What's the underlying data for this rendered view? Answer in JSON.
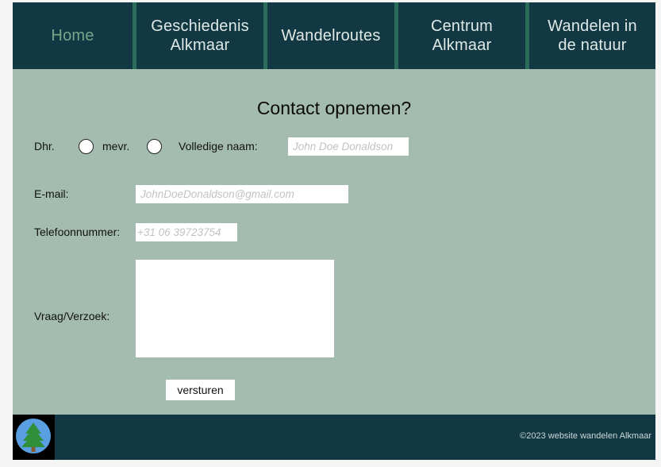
{
  "nav": {
    "items": [
      {
        "label": "Home",
        "active": true
      },
      {
        "label": "Geschiedenis\nAlkmaar"
      },
      {
        "label": "Wandelroutes"
      },
      {
        "label": "Centrum\nAlkmaar"
      },
      {
        "label": "Wandelen in\nde natuur"
      }
    ]
  },
  "form": {
    "title": "Contact opnemen?",
    "salutation_dhr": "Dhr.",
    "salutation_mevr": "mevr.",
    "name_label": "Volledige naam:",
    "name_placeholder": "John Doe Donaldson",
    "email_label": "E-mail:",
    "email_placeholder": "JohnDoeDonaldson@gmail.com",
    "phone_label": "Telefoonnummer:",
    "phone_placeholder": "+31 06 39723754",
    "message_label": "Vraag/Verzoek:",
    "submit_label": "versturen"
  },
  "footer": {
    "copyright": "©2023 website wandelen Alkmaar",
    "logo_icon": "tree-logo-icon"
  },
  "colors": {
    "nav_bg": "#123843",
    "nav_separator": "#2b6b5a",
    "nav_active": "#74a88c",
    "page_bg": "#a4bcaf",
    "footer_bg": "#123843"
  }
}
